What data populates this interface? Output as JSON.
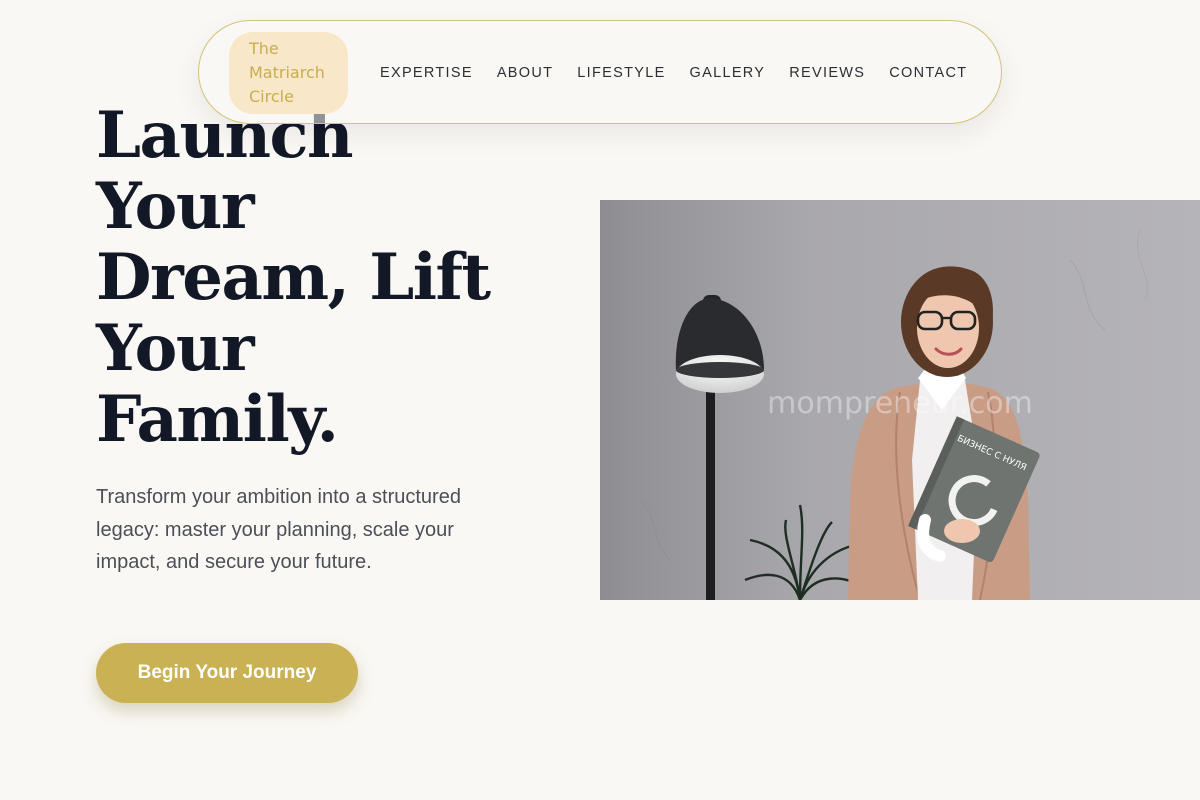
{
  "brand": {
    "lines": [
      "The",
      "Matriarch",
      "Circle"
    ]
  },
  "nav": {
    "items": [
      {
        "label": "EXPERTISE"
      },
      {
        "label": "ABOUT"
      },
      {
        "label": "LIFESTYLE"
      },
      {
        "label": "GALLERY"
      },
      {
        "label": "REVIEWS"
      },
      {
        "label": "CONTACT"
      }
    ]
  },
  "hero": {
    "title_lines": [
      "Launch",
      "Your",
      "Dream, Lift",
      "Your",
      "Family."
    ],
    "subtitle": "Transform your ambition into a structured legacy: master your planning, scale your impact, and secure your future.",
    "cta_label": "Begin Your Journey",
    "image": {
      "watermark": "mompreneur.com",
      "book_title": "БИЗНЕС С НУЛЯ"
    }
  },
  "colors": {
    "background": "#faf8f4",
    "accent_gold": "#c9b154",
    "logo_bg": "#f8e8c9",
    "heading": "#121826",
    "body_text": "#4a4f58"
  }
}
